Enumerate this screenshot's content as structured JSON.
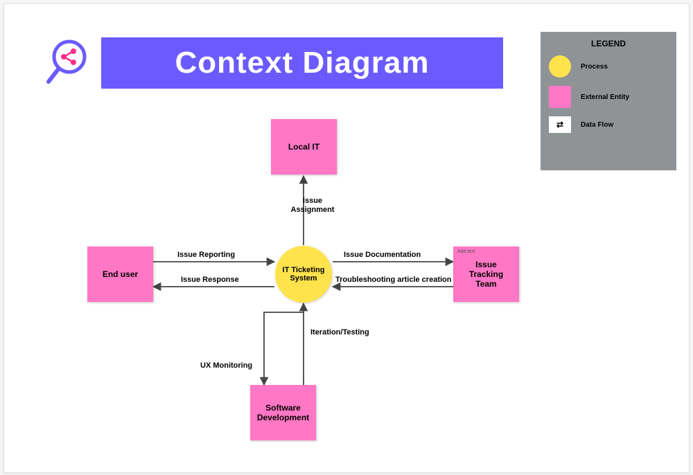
{
  "title": "Context Diagram",
  "legend": {
    "heading": "LEGEND",
    "process": "Process",
    "entity": "External Entity",
    "flow": "Data Flow"
  },
  "process": {
    "label": "IT Ticketing System"
  },
  "entities": {
    "local_it": "Local IT",
    "end_user": "End user",
    "issue_tracking": "Issue Tracking Team",
    "issue_tracking_note": "Add text",
    "software_dev": "Software Development"
  },
  "flows": {
    "issue_assignment": "Issue Assignment",
    "issue_reporting": "Issue Reporting",
    "issue_response": "Issue Response",
    "issue_documentation": "Issue Documentation",
    "troubleshooting": "Troubleshooting article creation",
    "iteration_testing": "Iteration/Testing",
    "ux_monitoring": "UX Monitoring"
  }
}
